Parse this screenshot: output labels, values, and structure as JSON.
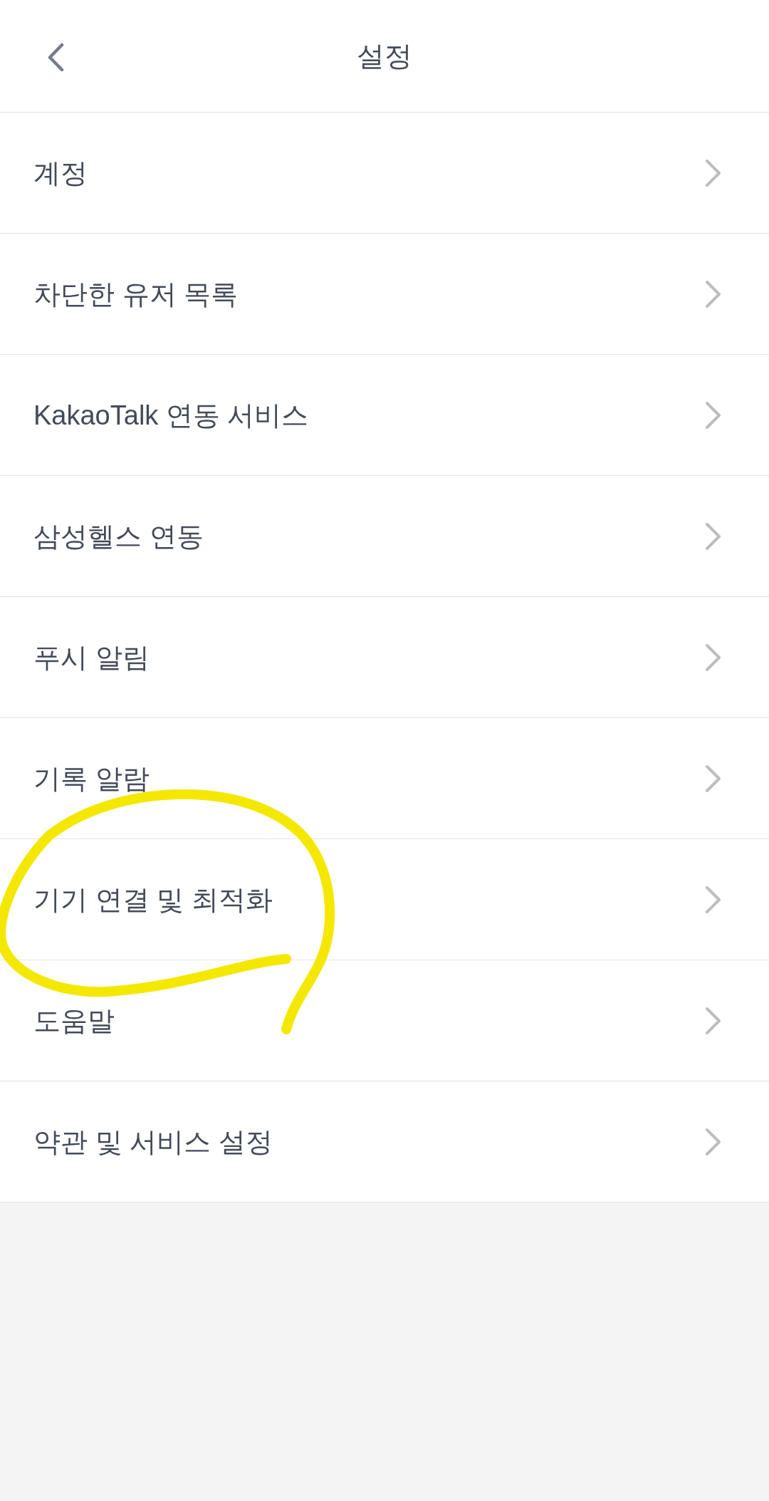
{
  "header": {
    "title": "설정"
  },
  "items": [
    {
      "label": "계정",
      "circled": false
    },
    {
      "label": "차단한 유저 목록",
      "circled": false
    },
    {
      "label": "KakaoTalk 연동 서비스",
      "circled": false
    },
    {
      "label": "삼성헬스 연동",
      "circled": false
    },
    {
      "label": "푸시 알림",
      "circled": false
    },
    {
      "label": "기록 알람",
      "circled": false
    },
    {
      "label": "기기 연결 및 최적화",
      "circled": true
    },
    {
      "label": "도움말",
      "circled": false
    },
    {
      "label": "약관 및 서비스 설정",
      "circled": false
    }
  ]
}
